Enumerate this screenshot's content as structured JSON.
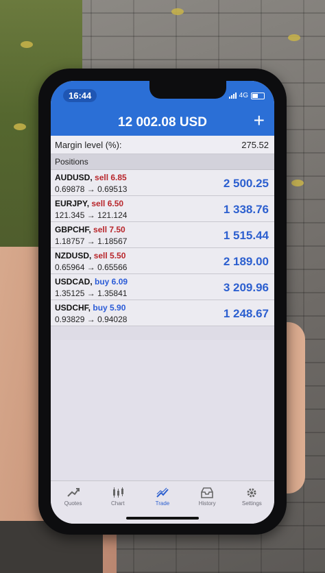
{
  "status_bar": {
    "time": "16:44",
    "network": "4G"
  },
  "header": {
    "balance": "12 002.08 USD",
    "add_symbol": "+"
  },
  "margin": {
    "label": "Margin level (%):",
    "value": "275.52"
  },
  "positions_title": "Positions",
  "positions": [
    {
      "symbol": "AUDUSD,",
      "type": "sell 6.85",
      "open": "0.69878",
      "arrow": "→",
      "current": "0.69513",
      "profit": "2 500.25"
    },
    {
      "symbol": "EURJPY,",
      "type": "sell 6.50",
      "open": "121.345",
      "arrow": "→",
      "current": "121.124",
      "profit": "1 338.76"
    },
    {
      "symbol": "GBPCHF,",
      "type": "sell 7.50",
      "open": "1.18757",
      "arrow": "→",
      "current": "1.18567",
      "profit": "1 515.44"
    },
    {
      "symbol": "NZDUSD,",
      "type": "sell 5.50",
      "open": "0.65964",
      "arrow": "→",
      "current": "0.65566",
      "profit": "2 189.00"
    },
    {
      "symbol": "USDCAD,",
      "type": "buy 6.09",
      "open": "1.35125",
      "arrow": "→",
      "current": "1.35841",
      "profit": "3 209.96"
    },
    {
      "symbol": "USDCHF,",
      "type": "buy 5.90",
      "open": "0.93829",
      "arrow": "→",
      "current": "0.94028",
      "profit": "1 248.67"
    }
  ],
  "tabs": [
    {
      "label": "Quotes",
      "icon": "quotes-icon"
    },
    {
      "label": "Chart",
      "icon": "chart-icon"
    },
    {
      "label": "Trade",
      "icon": "trade-icon",
      "active": true
    },
    {
      "label": "History",
      "icon": "history-icon"
    },
    {
      "label": "Settings",
      "icon": "settings-icon"
    }
  ],
  "colors": {
    "header": "#2b6fd6",
    "sell": "#b8262b",
    "buy": "#2a5bd7",
    "profit": "#2c5fcf"
  }
}
